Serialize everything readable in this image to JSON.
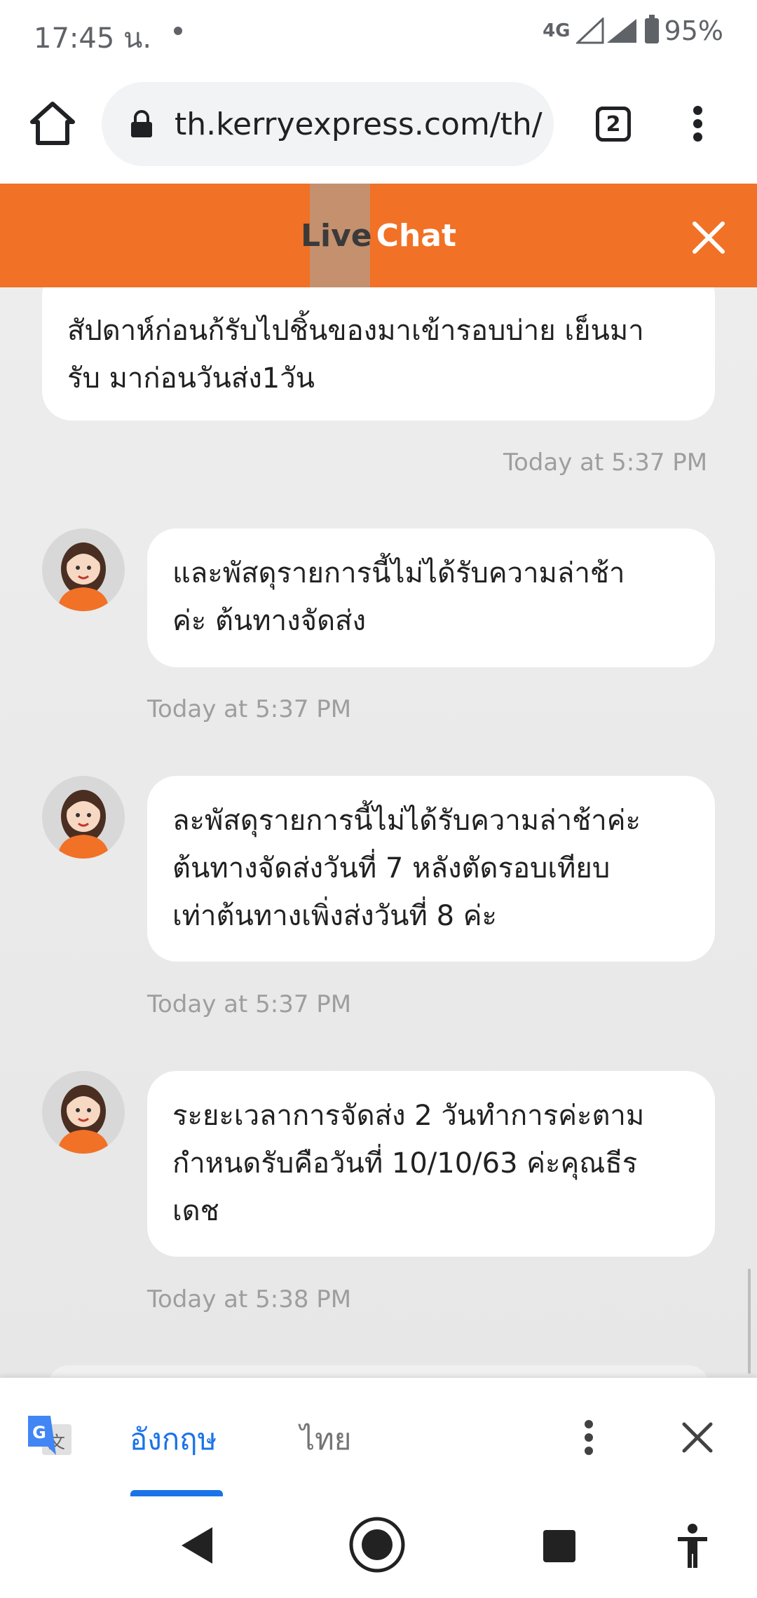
{
  "status_bar": {
    "time": "17:45 น.",
    "network": "4G",
    "battery": "95%"
  },
  "browser": {
    "url": "th.kerryexpress.com/th/",
    "tab_count": "2"
  },
  "chat": {
    "title_part1": "Live",
    "title_part2": "Chat",
    "brand_color": "#f17126",
    "messages": [
      {
        "type": "user",
        "lines": [
          "สัปดาห์ก่อนก้รับไปชิ้นของมาเข้ารอบบ่าย เย็นมา",
          "รับ มาก่อนวันส่ง1วัน"
        ],
        "time": "Today at 5:37 PM"
      },
      {
        "type": "agent",
        "lines": [
          "และพัสดุรายการนี้ไม่ได้รับความล่าช้า",
          "ค่ะ ต้นทางจัดส่ง"
        ],
        "time": "Today at 5:37 PM"
      },
      {
        "type": "agent",
        "lines": [
          "ละพัสดุรายการนี้ไม่ได้รับความล่าช้าค่ะ",
          "ต้นทางจัดส่งวันที่ 7 หลังตัดรอบเทียบ",
          "เท่าต้นทางเพิ่งส่งวันที่ 8 ค่ะ"
        ],
        "time": "Today at 5:37 PM"
      },
      {
        "type": "agent",
        "lines": [
          "ระยะเวลาการจัดส่ง 2 วันทำการค่ะตาม",
          "กำหนดรับคือวันที่ 10/10/63 ค่ะคุณธีร",
          "เดช"
        ],
        "time": "Today at 5:38 PM"
      }
    ]
  },
  "translate_bar": {
    "language_source": "อังกฤษ",
    "language_target": "ไทย",
    "accent": "#1a73e8"
  }
}
